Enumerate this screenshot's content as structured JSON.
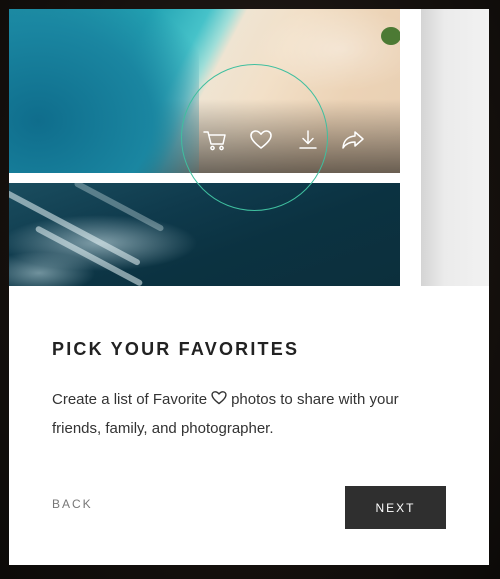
{
  "gallery": {
    "photos": [
      {
        "alt_subject": "aerial beach"
      },
      {
        "alt_subject": "ocean waves"
      }
    ],
    "actions": [
      {
        "icon": "cart-icon"
      },
      {
        "icon": "heart-icon"
      },
      {
        "icon": "download-icon"
      },
      {
        "icon": "share-icon"
      }
    ],
    "highlight_color": "#3fbf9f"
  },
  "tutorial": {
    "title": "PICK YOUR FAVORITES",
    "description_before": "Create a list of Favorite",
    "description_icon": "heart-icon",
    "description_after": "photos to share with your friends, family, and photographer.",
    "back_label": "BACK",
    "next_label": "NEXT"
  }
}
